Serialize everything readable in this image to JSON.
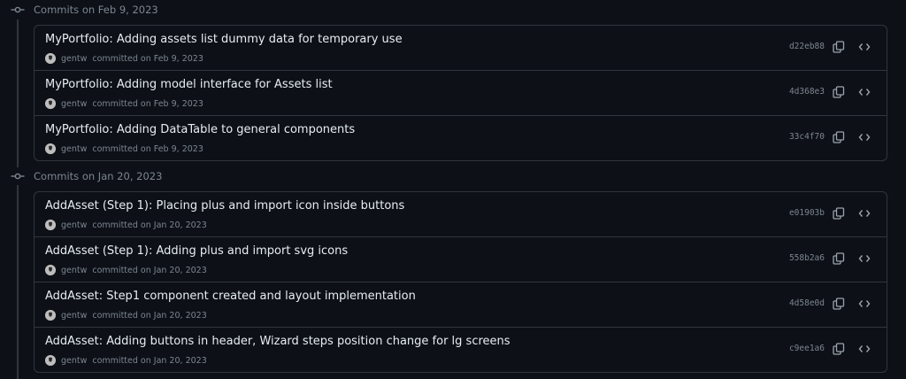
{
  "groups": [
    {
      "title": "Commits on Feb 9, 2023",
      "commits": [
        {
          "message": "MyPortfolio: Adding assets list dummy data for temporary use",
          "author": "gentw",
          "committed": "committed on Feb 9, 2023",
          "sha": "d22eb88"
        },
        {
          "message": "MyPortfolio: Adding model interface for Assets list",
          "author": "gentw",
          "committed": "committed on Feb 9, 2023",
          "sha": "4d368e3"
        },
        {
          "message": "MyPortfolio: Adding DataTable to general components",
          "author": "gentw",
          "committed": "committed on Feb 9, 2023",
          "sha": "33c4f70"
        }
      ]
    },
    {
      "title": "Commits on Jan 20, 2023",
      "commits": [
        {
          "message": "AddAsset (Step 1): Placing plus and import icon inside buttons",
          "author": "gentw",
          "committed": "committed on Jan 20, 2023",
          "sha": "e01903b"
        },
        {
          "message": "AddAsset (Step 1): Adding plus and import svg icons",
          "author": "gentw",
          "committed": "committed on Jan 20, 2023",
          "sha": "558b2a6"
        },
        {
          "message": "AddAsset: Step1 component created and layout implementation",
          "author": "gentw",
          "committed": "committed on Jan 20, 2023",
          "sha": "4d58e0d"
        },
        {
          "message": "AddAsset: Adding buttons in header, Wizard steps position change for lg screens",
          "author": "gentw",
          "committed": "committed on Jan 20, 2023",
          "sha": "c9ee1a6"
        }
      ]
    }
  ],
  "icons": {
    "group": "git-commit-icon",
    "copy": "copy-icon",
    "browse": "code-icon",
    "avatar": "avatar"
  },
  "colors": {
    "background": "#0d1117",
    "border": "#30363d",
    "text": "#e6edf3",
    "muted": "#7d8590"
  }
}
